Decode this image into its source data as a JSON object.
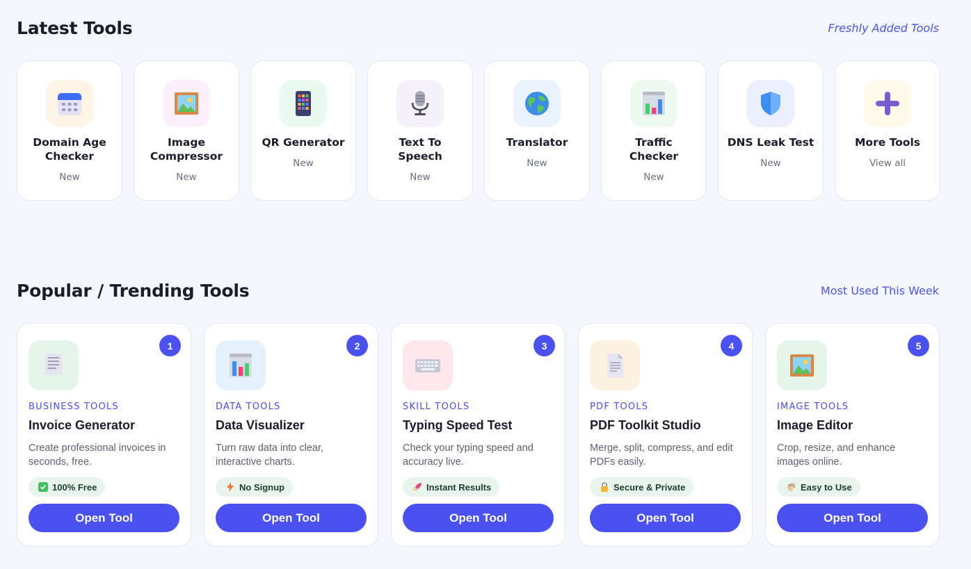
{
  "latest": {
    "title": "Latest Tools",
    "link": "Freshly Added Tools",
    "cards": [
      {
        "name": "Domain Age Checker",
        "sub": "New",
        "icon": "calendar-icon"
      },
      {
        "name": "Image Compressor",
        "sub": "New",
        "icon": "framed-picture-icon"
      },
      {
        "name": "QR Generator",
        "sub": "New",
        "icon": "keypad-icon"
      },
      {
        "name": "Text To Speech",
        "sub": "New",
        "icon": "microphone-icon"
      },
      {
        "name": "Translator",
        "sub": "New",
        "icon": "globe-icon"
      },
      {
        "name": "Traffic Checker",
        "sub": "New",
        "icon": "bar-chart-icon"
      },
      {
        "name": "DNS Leak Test",
        "sub": "New",
        "icon": "shield-icon"
      },
      {
        "name": "More Tools",
        "sub": "View all",
        "icon": "plus-icon"
      }
    ]
  },
  "popular": {
    "title": "Popular / Trending Tools",
    "link": "Most Used This Week",
    "button_label": "Open Tool",
    "cards": [
      {
        "rank": "1",
        "category": "BUSINESS TOOLS",
        "name": "Invoice Generator",
        "desc": "Create professional invoices in seconds, free.",
        "tag": "100% Free",
        "tag_icon": "check-mark-icon",
        "icon": "receipt-icon"
      },
      {
        "rank": "2",
        "category": "DATA TOOLS",
        "name": "Data Visualizer",
        "desc": "Turn raw data into clear, interactive charts.",
        "tag": "No Signup",
        "tag_icon": "lightning-icon",
        "icon": "bar-chart-icon"
      },
      {
        "rank": "3",
        "category": "SKILL TOOLS",
        "name": "Typing Speed Test",
        "desc": "Check your typing speed and accuracy live.",
        "tag": "Instant Results",
        "tag_icon": "rocket-icon",
        "icon": "keyboard-icon"
      },
      {
        "rank": "4",
        "category": "PDF TOOLS",
        "name": "PDF Toolkit Studio",
        "desc": "Merge, split, compress, and edit PDFs easily.",
        "tag": "Secure & Private",
        "tag_icon": "lock-icon",
        "icon": "document-icon"
      },
      {
        "rank": "5",
        "category": "IMAGE TOOLS",
        "name": "Image Editor",
        "desc": "Crop, resize, and enhance images online.",
        "tag": "Easy to Use",
        "tag_icon": "palette-icon",
        "icon": "framed-picture-icon"
      }
    ]
  },
  "colors": {
    "accent": "#4a51f0",
    "background": "#f5f7fd",
    "tag_background": "#e8f5ec"
  }
}
